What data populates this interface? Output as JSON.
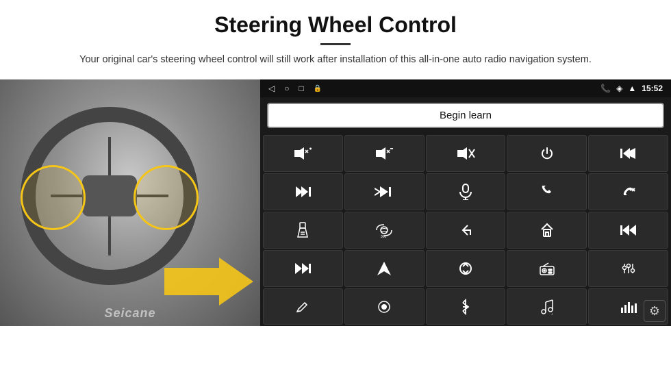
{
  "header": {
    "title": "Steering Wheel Control",
    "subtitle": "Your original car's steering wheel control will still work after installation of this all-in-one auto radio navigation system."
  },
  "statusbar": {
    "time": "15:52",
    "icons": [
      "◁",
      "○",
      "□",
      "🔒"
    ]
  },
  "begin_learn_label": "Begin learn",
  "controls": [
    {
      "icon": "🔊+",
      "label": "vol-up"
    },
    {
      "icon": "🔊−",
      "label": "vol-down"
    },
    {
      "icon": "🔇",
      "label": "mute"
    },
    {
      "icon": "⏻",
      "label": "power"
    },
    {
      "icon": "⏮",
      "label": "prev-track"
    },
    {
      "icon": "⏭",
      "label": "next"
    },
    {
      "icon": "✂⏭",
      "label": "skip"
    },
    {
      "icon": "🎤",
      "label": "mic"
    },
    {
      "icon": "📞",
      "label": "call"
    },
    {
      "icon": "📞↩",
      "label": "hangup"
    },
    {
      "icon": "🔦",
      "label": "flashlight"
    },
    {
      "icon": "👁360",
      "label": "360view"
    },
    {
      "icon": "↩",
      "label": "back"
    },
    {
      "icon": "⌂",
      "label": "home"
    },
    {
      "icon": "⏮⏮",
      "label": "rewind"
    },
    {
      "icon": "⏭⏭",
      "label": "fast-forward"
    },
    {
      "icon": "▶",
      "label": "play"
    },
    {
      "icon": "⇄",
      "label": "switch"
    },
    {
      "icon": "📻",
      "label": "radio"
    },
    {
      "icon": "🎚",
      "label": "equalizer"
    },
    {
      "icon": "✏",
      "label": "edit"
    },
    {
      "icon": "⏺",
      "label": "record"
    },
    {
      "icon": "🔵",
      "label": "bluetooth"
    },
    {
      "icon": "🎵",
      "label": "music"
    },
    {
      "icon": "📊",
      "label": "spectrum"
    }
  ],
  "watermark": "Seicane",
  "gear_label": "⚙"
}
